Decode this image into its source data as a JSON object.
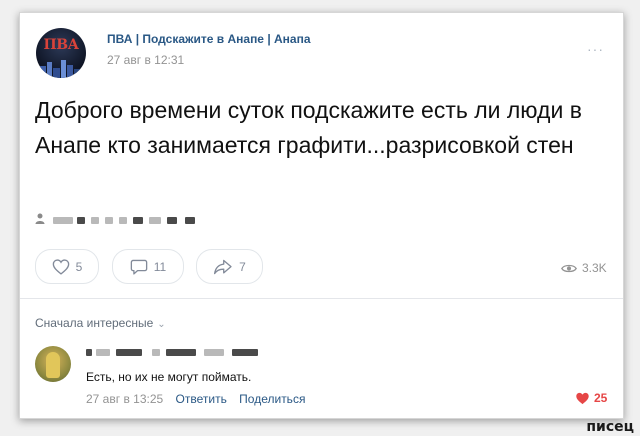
{
  "post": {
    "group_name": "ПВА | Подскажите в Анапе | Анапа",
    "time": "27 авг в 12:31",
    "more_label": "···",
    "avatar_text": "ПВА",
    "text": "Доброго времени суток подскажите есть ли люди в Анапе кто занимается графити...разрисовкой стен",
    "actions": {
      "likes": "5",
      "comments": "11",
      "shares": "7",
      "views": "3.3K"
    }
  },
  "comments": {
    "sort_label": "Сначала интересные",
    "items": [
      {
        "text": "Есть, но их не могут поймать.",
        "time": "27 авг в 13:25",
        "reply_label": "Ответить",
        "share_label": "Поделиться",
        "likes": "25"
      }
    ]
  },
  "watermark": "писец",
  "colors": {
    "link": "#2a5885",
    "muted": "#939393",
    "like_active": "#e64646",
    "icon": "#828a99"
  }
}
